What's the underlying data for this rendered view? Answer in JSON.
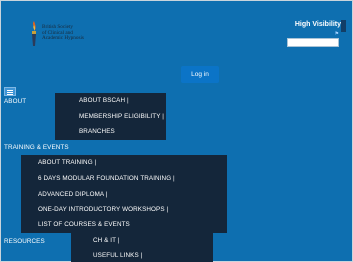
{
  "brand": {
    "logo_lines": [
      "British Society",
      "of Clinical and",
      "Academic Hypnosis"
    ]
  },
  "header": {
    "accessibility_label": "High Visibility",
    "login_label": "Log in"
  },
  "nav": {
    "about": {
      "label": "ABOUT",
      "children": [
        "ABOUT BSCAH |",
        "MEMBERSHIP ELIGIBILITY |",
        "BRANCHES"
      ]
    },
    "training": {
      "label": "TRAINING & EVENTS",
      "children": [
        "ABOUT TRAINING |",
        "6 DAYS MODULAR FOUNDATION TRAINING |",
        "ADVANCED DIPLOMA |",
        "ONE-DAY INTRODUCTORY WORKSHOPS |",
        "LIST OF COURSES & EVENTS"
      ]
    },
    "resources": {
      "label": "RESOURCES",
      "children": [
        "CH & IT |",
        "USEFUL LINKS |"
      ]
    }
  },
  "colors": {
    "background": "#0e6fb0",
    "dropdown": "#14263a",
    "button": "#0b74c7"
  }
}
